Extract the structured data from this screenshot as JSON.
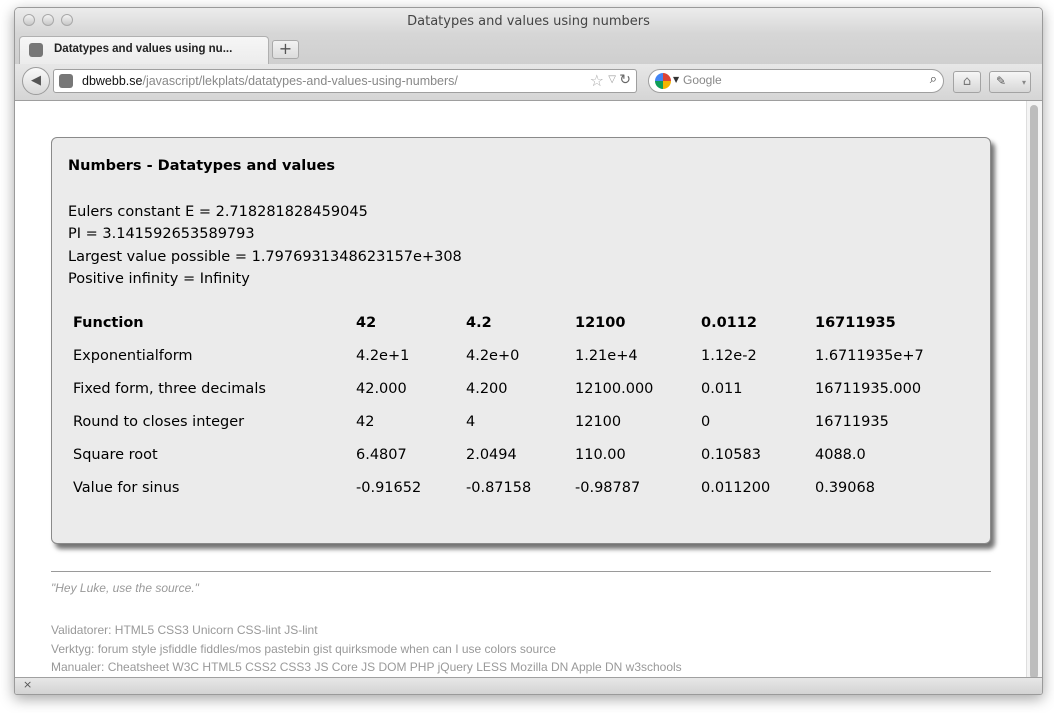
{
  "window": {
    "title": "Datatypes and values using numbers"
  },
  "tab": {
    "label": "Datatypes and values using nu...",
    "close": "×"
  },
  "toolbar": {
    "new_tab_icon": "+",
    "back_icon": "◀",
    "url_host": "dbwebb.se",
    "url_path": "/javascript/lekplats/datatypes-and-values-using-numbers/",
    "star_icon": "☆",
    "drop_icon": "▽",
    "reload_icon": "↻",
    "search_placeholder": "Google",
    "search_icon": "⌕",
    "home_icon": "⌂",
    "tools_icon": "✎",
    "tools_drop_icon": "▾"
  },
  "page": {
    "heading": "Numbers - Datatypes and values",
    "facts": [
      "Eulers constant E = 2.718281828459045",
      "PI = 3.141592653589793",
      "Largest value possible = 1.7976931348623157e+308",
      "Positive infinity = Infinity"
    ],
    "table": {
      "headers": [
        "Function",
        "42",
        "4.2",
        "12100",
        "0.0112",
        "16711935"
      ],
      "rows": [
        [
          "Exponentialform",
          "4.2e+1",
          "4.2e+0",
          "1.21e+4",
          "1.12e-2",
          "1.6711935e+7"
        ],
        [
          "Fixed form, three decimals",
          "42.000",
          "4.200",
          "12100.000",
          "0.011",
          "16711935.000"
        ],
        [
          "Round to closes integer",
          "42",
          "4",
          "12100",
          "0",
          "16711935"
        ],
        [
          "Square root",
          "6.4807",
          "2.0494",
          "110.00",
          "0.10583",
          "4088.0"
        ],
        [
          "Value for sinus",
          "-0.91652",
          "-0.87158",
          "-0.98787",
          "0.011200",
          "0.39068"
        ]
      ]
    }
  },
  "footer": {
    "quote": "\"Hey Luke, use the source.\"",
    "lines": [
      "Validatorer: HTML5 CSS3 Unicorn CSS-lint JS-lint",
      "Verktyg: forum style jsfiddle fiddles/mos pastebin gist quirksmode when can I use colors source",
      "Manualer: Cheatsheet W3C HTML5 CSS2 CSS3 JS Core JS DOM PHP jQuery LESS Mozilla DN Apple DN w3schools"
    ]
  },
  "statusbar": {
    "close_icon": "×"
  },
  "colors": {
    "panel_bg": "#ebebeb",
    "footer_text": "#999999",
    "chrome": "#d6d6d6"
  }
}
